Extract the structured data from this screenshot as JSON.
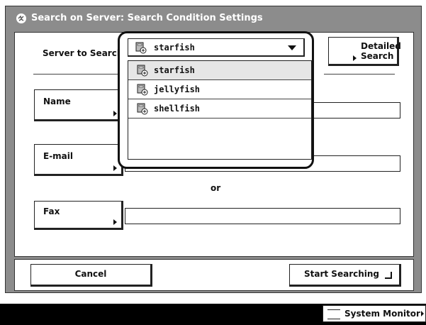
{
  "window": {
    "title": "Search on Server: Search Condition Settings",
    "icon": "search-globe-icon"
  },
  "server": {
    "label": "Server to Search",
    "selected": "starfish",
    "options": [
      "starfish",
      "jellyfish",
      "shellfish"
    ]
  },
  "detailed_search": {
    "line1": "Detailed",
    "line2": "Search"
  },
  "fields": {
    "name": {
      "label": "Name",
      "value": ""
    },
    "email": {
      "label": "E-mail",
      "value": ""
    },
    "or_text": "or",
    "fax": {
      "label": "Fax",
      "value": ""
    }
  },
  "buttons": {
    "cancel": "Cancel",
    "start": "Start Searching"
  },
  "status": {
    "system_monitor": "System Monitor"
  }
}
